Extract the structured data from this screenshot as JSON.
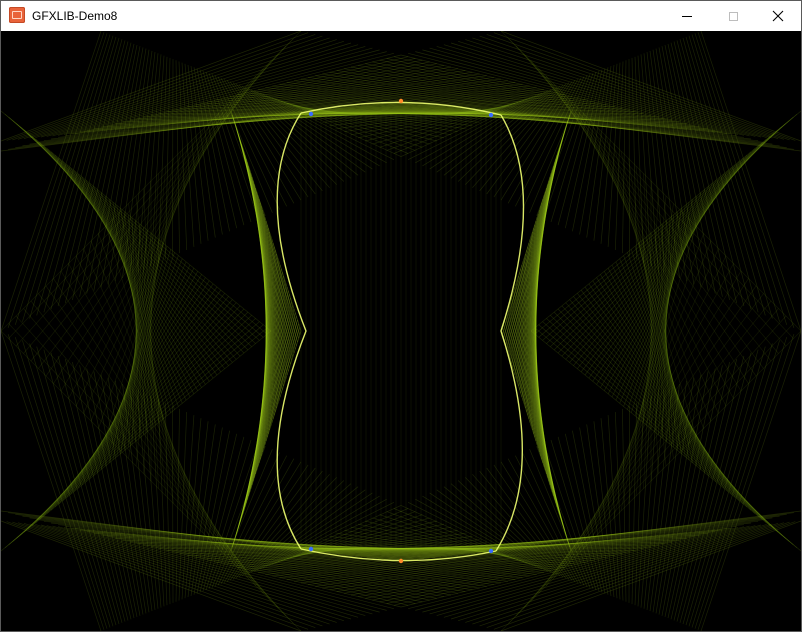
{
  "window": {
    "title": "GFXLIB-Demo8",
    "app_icon": "gfxlib-app-icon",
    "controls": {
      "minimize_icon": "minimize-icon",
      "maximize_icon": "maximize-icon",
      "close_icon": "close-icon"
    }
  },
  "canvas": {
    "background": "#000000",
    "line_color": "#a4d41c",
    "highlight_color": "#f0ff70",
    "accent_colors": [
      "#3a6cff",
      "#ff8a2a"
    ]
  }
}
